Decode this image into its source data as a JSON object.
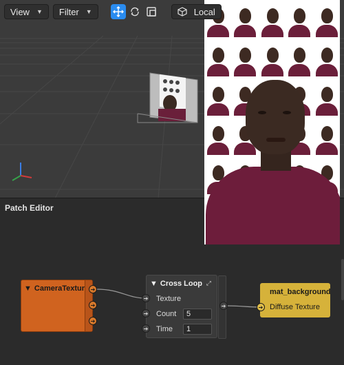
{
  "toolbar": {
    "view_label": "View",
    "filter_label": "Filter",
    "local_label": "Local",
    "tools": [
      "move-icon",
      "rotate-icon",
      "scale-icon"
    ]
  },
  "patch_editor": {
    "title": "Patch Editor",
    "camera_node": {
      "label": "CameraTexture"
    },
    "loop_node": {
      "label": "Cross Loop",
      "texture_label": "Texture",
      "count_label": "Count",
      "count_value": "5",
      "time_label": "Time",
      "time_value": "1"
    },
    "material_node": {
      "label": "mat_background",
      "input_label": "Diffuse Texture"
    }
  },
  "colors": {
    "accent": "#2a8cf0",
    "camera_node": "#d0631f",
    "material_node": "#d6b23a"
  }
}
